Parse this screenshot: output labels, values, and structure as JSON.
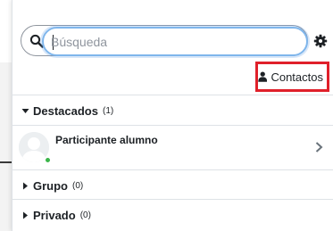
{
  "search": {
    "placeholder": "Búsqueda",
    "value": ""
  },
  "toolbar": {
    "settings_icon": "gear-icon",
    "contacts_label": "Contactos",
    "contacts_icon": "person-icon"
  },
  "sections": {
    "starred": {
      "title": "Destacados",
      "count": "(1)",
      "expanded": true
    },
    "group": {
      "title": "Grupo",
      "count": "(0)",
      "expanded": false
    },
    "private": {
      "title": "Privado",
      "count": "(0)",
      "expanded": false
    }
  },
  "contacts": [
    {
      "name": "Participante alumno",
      "status": "online"
    }
  ],
  "colors": {
    "accent_focus": "#7fb6ec",
    "highlight_border": "#e0202a",
    "online": "#3bb54a",
    "divider": "#dee2e6"
  }
}
